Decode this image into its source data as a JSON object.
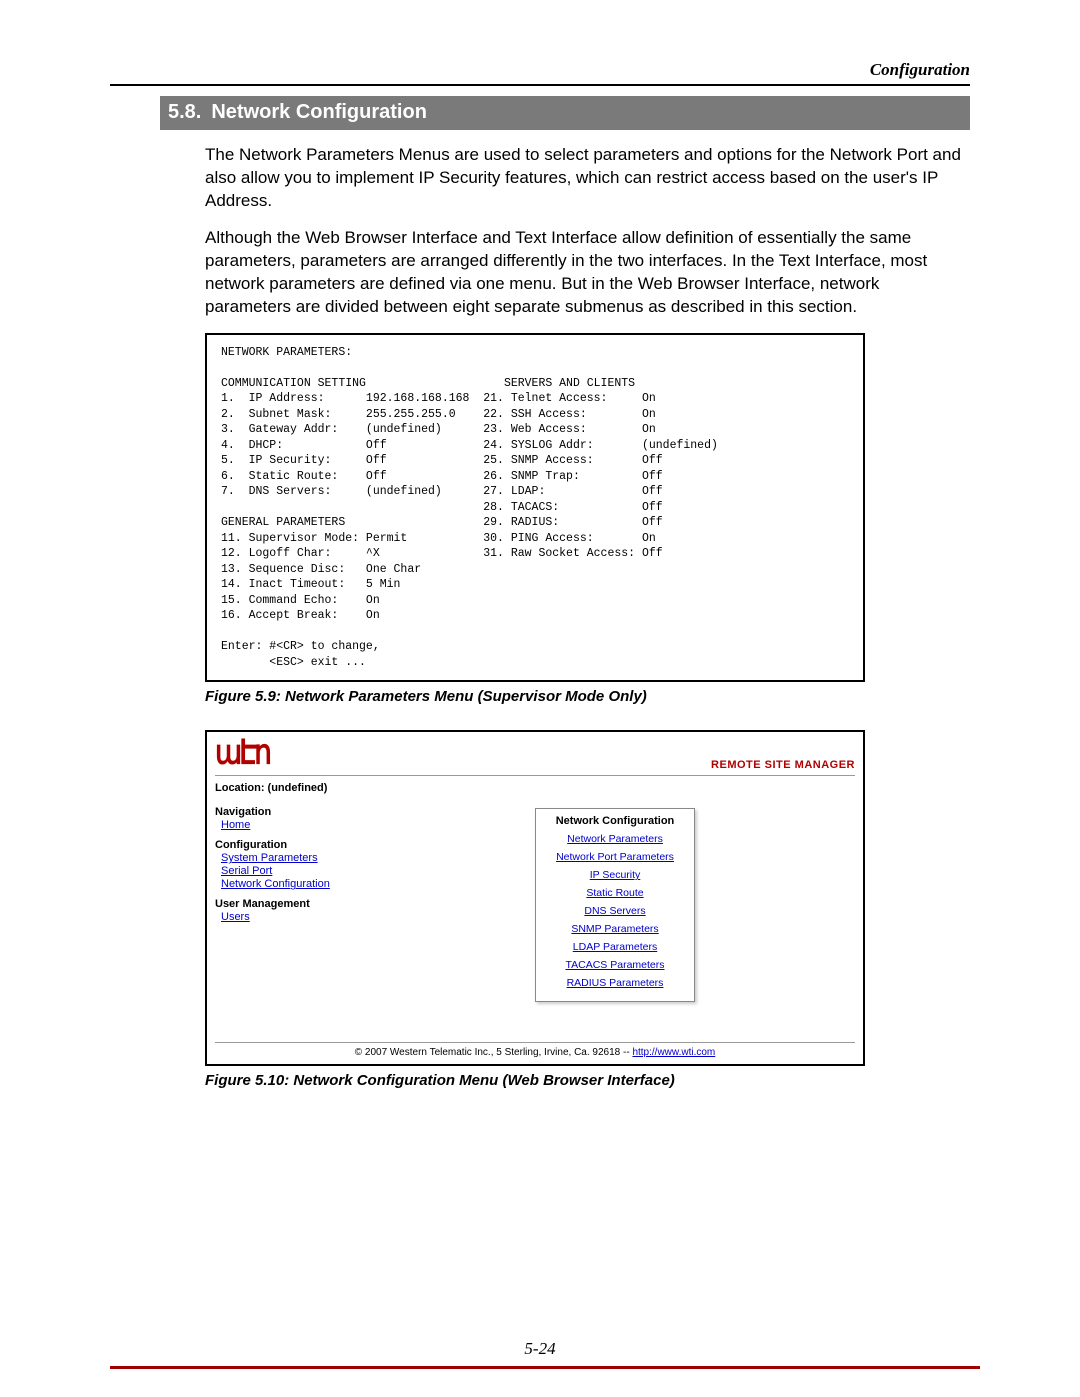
{
  "header": "Configuration",
  "section_number": "5.8.",
  "section_title": "Network Configuration",
  "para1": "The Network Parameters Menus are used to select parameters and options for the Network Port and also allow you to implement IP Security features, which can restrict access based on the user's IP Address.",
  "para2": "Although the Web Browser Interface and Text Interface allow definition of essentially the same parameters, parameters are arranged differently in the two interfaces.  In the Text Interface, most network parameters are defined via one menu.  But in the Web Browser Interface, network parameters are divided between eight separate submenus as described in this section.",
  "text_menu": "NETWORK PARAMETERS:\n\nCOMMUNICATION SETTING                    SERVERS AND CLIENTS\n1.  IP Address:      192.168.168.168  21. Telnet Access:     On\n2.  Subnet Mask:     255.255.255.0    22. SSH Access:        On\n3.  Gateway Addr:    (undefined)      23. Web Access:        On\n4.  DHCP:            Off              24. SYSLOG Addr:       (undefined)\n5.  IP Security:     Off              25. SNMP Access:       Off\n6.  Static Route:    Off              26. SNMP Trap:         Off\n7.  DNS Servers:     (undefined)      27. LDAP:              Off\n                                      28. TACACS:            Off\nGENERAL PARAMETERS                    29. RADIUS:            Off\n11. Supervisor Mode: Permit           30. PING Access:       On\n12. Logoff Char:     ^X               31. Raw Socket Access: Off\n13. Sequence Disc:   One Char\n14. Inact Timeout:   5 Min\n15. Command Echo:    On\n16. Accept Break:    On\n\nEnter: #<CR> to change,\n       <ESC> exit ...",
  "figure59_caption": "Figure 5.9:  Network Parameters Menu (Supervisor Mode Only)",
  "web": {
    "rsm": "REMOTE SITE MANAGER",
    "location": "Location: (undefined)",
    "nav_title": "Navigation",
    "nav_home": "Home",
    "cfg_title": "Configuration",
    "cfg_links": [
      "System Parameters",
      "Serial Port",
      "Network Configuration"
    ],
    "um_title": "User Management",
    "um_links": [
      "Users"
    ],
    "panel_title": "Network Configuration",
    "panel_links": [
      "Network Parameters",
      "Network Port Parameters",
      "IP Security",
      "Static Route",
      "DNS Servers",
      "SNMP Parameters",
      "LDAP Parameters",
      "TACACS Parameters",
      "RADIUS Parameters"
    ],
    "footer_text": "© 2007 Western Telematic Inc., 5 Sterling, Irvine, Ca. 92618 -- ",
    "footer_link": "http://www.wti.com"
  },
  "figure510_caption": "Figure 5.10:  Network Configuration Menu (Web Browser Interface)",
  "page_number": "5-24"
}
